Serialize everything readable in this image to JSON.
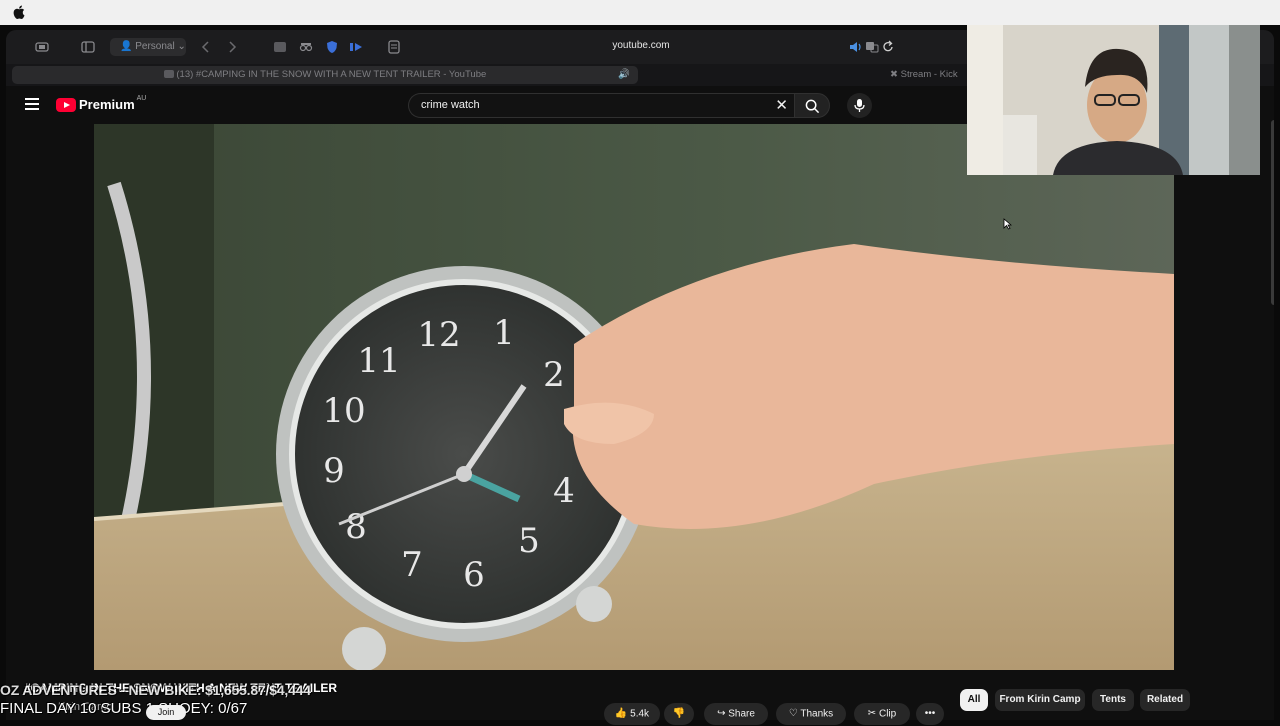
{
  "browser": {
    "profile_label": "Personal",
    "address": "youtube.com",
    "tabs": [
      {
        "label": "(13) #CAMPING IN THE SNOW WITH A NEW TENT TRAILER - YouTube",
        "active": true
      },
      {
        "label": "Stream - Kick",
        "active": false
      }
    ]
  },
  "youtube": {
    "logo_text": "Premium",
    "region": "AU",
    "search_query": "crime watch",
    "video_title": "#CAMPING IN THE SNOW WITH A NEW TENT TRAILER",
    "channel_name": "Kirin Camp",
    "join_label": "Join",
    "actions": {
      "like_count": "5.4k",
      "share_label": "Share",
      "thanks_label": "Thanks",
      "clip_label": "Clip"
    },
    "chips": [
      {
        "label": "All",
        "active": true
      },
      {
        "label": "From Kirin Camp",
        "active": false
      },
      {
        "label": "Tents",
        "active": false
      },
      {
        "label": "Related",
        "active": false
      }
    ]
  },
  "stream_overlay": {
    "line1": "OZ ADVENTURES - NEW BIKE: $1,655.87/$4,444",
    "line2": "FINAL DAY 10 SUBS 1 SHOEY: 0/67"
  },
  "colors": {
    "youtube_red": "#ff0033",
    "background": "#0f0f0f",
    "chip_active": "#f1f1f1"
  }
}
